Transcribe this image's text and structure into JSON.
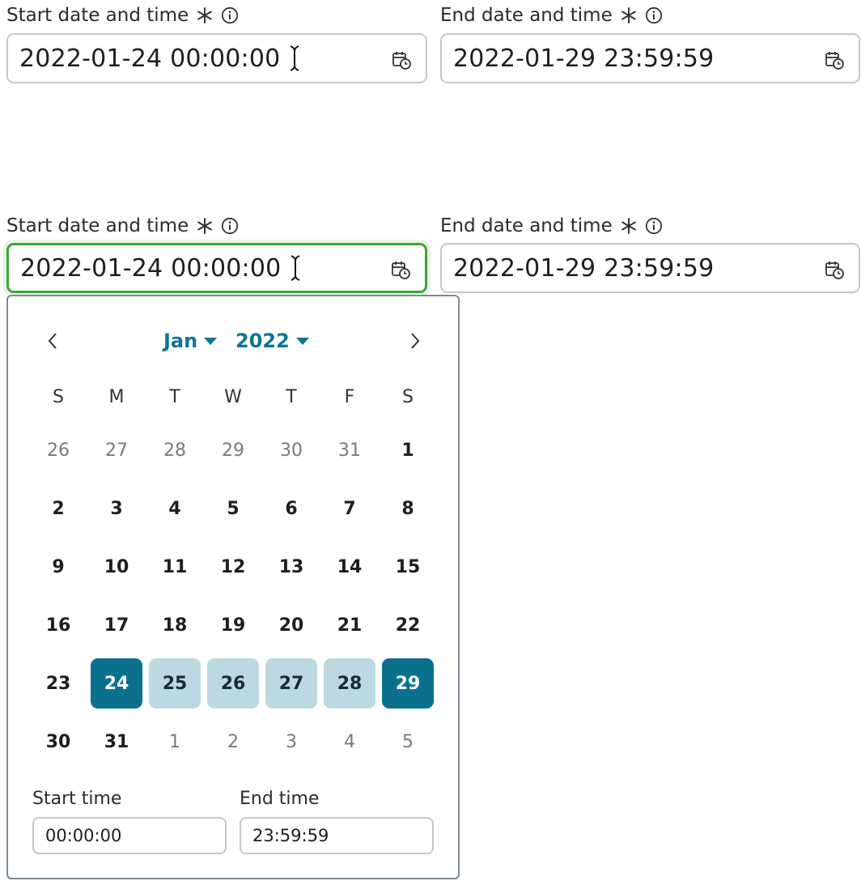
{
  "top": {
    "start": {
      "label": "Start date and time",
      "value": "2022-01-24 00:00:00"
    },
    "end": {
      "label": "End date and time",
      "value": "2022-01-29 23:59:59"
    }
  },
  "bottom": {
    "start": {
      "label": "Start date and time",
      "value": "2022-01-24 00:00:00"
    },
    "end": {
      "label": "End date and time",
      "value": "2022-01-29 23:59:59"
    }
  },
  "calendar": {
    "month": "Jan",
    "year": "2022",
    "weekdays": [
      "S",
      "M",
      "T",
      "W",
      "T",
      "F",
      "S"
    ],
    "weeks": [
      [
        {
          "d": "26",
          "t": "other"
        },
        {
          "d": "27",
          "t": "other"
        },
        {
          "d": "28",
          "t": "other"
        },
        {
          "d": "29",
          "t": "other"
        },
        {
          "d": "30",
          "t": "other"
        },
        {
          "d": "31",
          "t": "other"
        },
        {
          "d": "1",
          "t": "current"
        }
      ],
      [
        {
          "d": "2",
          "t": "current"
        },
        {
          "d": "3",
          "t": "current"
        },
        {
          "d": "4",
          "t": "current"
        },
        {
          "d": "5",
          "t": "current"
        },
        {
          "d": "6",
          "t": "current"
        },
        {
          "d": "7",
          "t": "current"
        },
        {
          "d": "8",
          "t": "current"
        }
      ],
      [
        {
          "d": "9",
          "t": "current"
        },
        {
          "d": "10",
          "t": "current"
        },
        {
          "d": "11",
          "t": "current"
        },
        {
          "d": "12",
          "t": "current"
        },
        {
          "d": "13",
          "t": "current"
        },
        {
          "d": "14",
          "t": "current"
        },
        {
          "d": "15",
          "t": "current"
        }
      ],
      [
        {
          "d": "16",
          "t": "current"
        },
        {
          "d": "17",
          "t": "current"
        },
        {
          "d": "18",
          "t": "current"
        },
        {
          "d": "19",
          "t": "current"
        },
        {
          "d": "20",
          "t": "current"
        },
        {
          "d": "21",
          "t": "current"
        },
        {
          "d": "22",
          "t": "current"
        }
      ],
      [
        {
          "d": "23",
          "t": "current"
        },
        {
          "d": "24",
          "t": "endpoint"
        },
        {
          "d": "25",
          "t": "inrange"
        },
        {
          "d": "26",
          "t": "inrange"
        },
        {
          "d": "27",
          "t": "inrange"
        },
        {
          "d": "28",
          "t": "inrange"
        },
        {
          "d": "29",
          "t": "endpoint"
        }
      ],
      [
        {
          "d": "30",
          "t": "current"
        },
        {
          "d": "31",
          "t": "current"
        },
        {
          "d": "1",
          "t": "other"
        },
        {
          "d": "2",
          "t": "other"
        },
        {
          "d": "3",
          "t": "other"
        },
        {
          "d": "4",
          "t": "other"
        },
        {
          "d": "5",
          "t": "other"
        }
      ]
    ],
    "start_time_label": "Start time",
    "start_time_value": "00:00:00",
    "end_time_label": "End time",
    "end_time_value": "23:59:59"
  },
  "icons": {
    "required": "asterisk-icon",
    "info": "info-icon",
    "calendar": "calendar-clock-icon",
    "prev": "chevron-left-icon",
    "next": "chevron-right-icon",
    "caret": "caret-down-icon",
    "cursor": "text-cursor-icon"
  },
  "colors": {
    "accent": "#0b708e",
    "range_fill": "#bcd9e2",
    "focus_border": "#3ba534"
  }
}
